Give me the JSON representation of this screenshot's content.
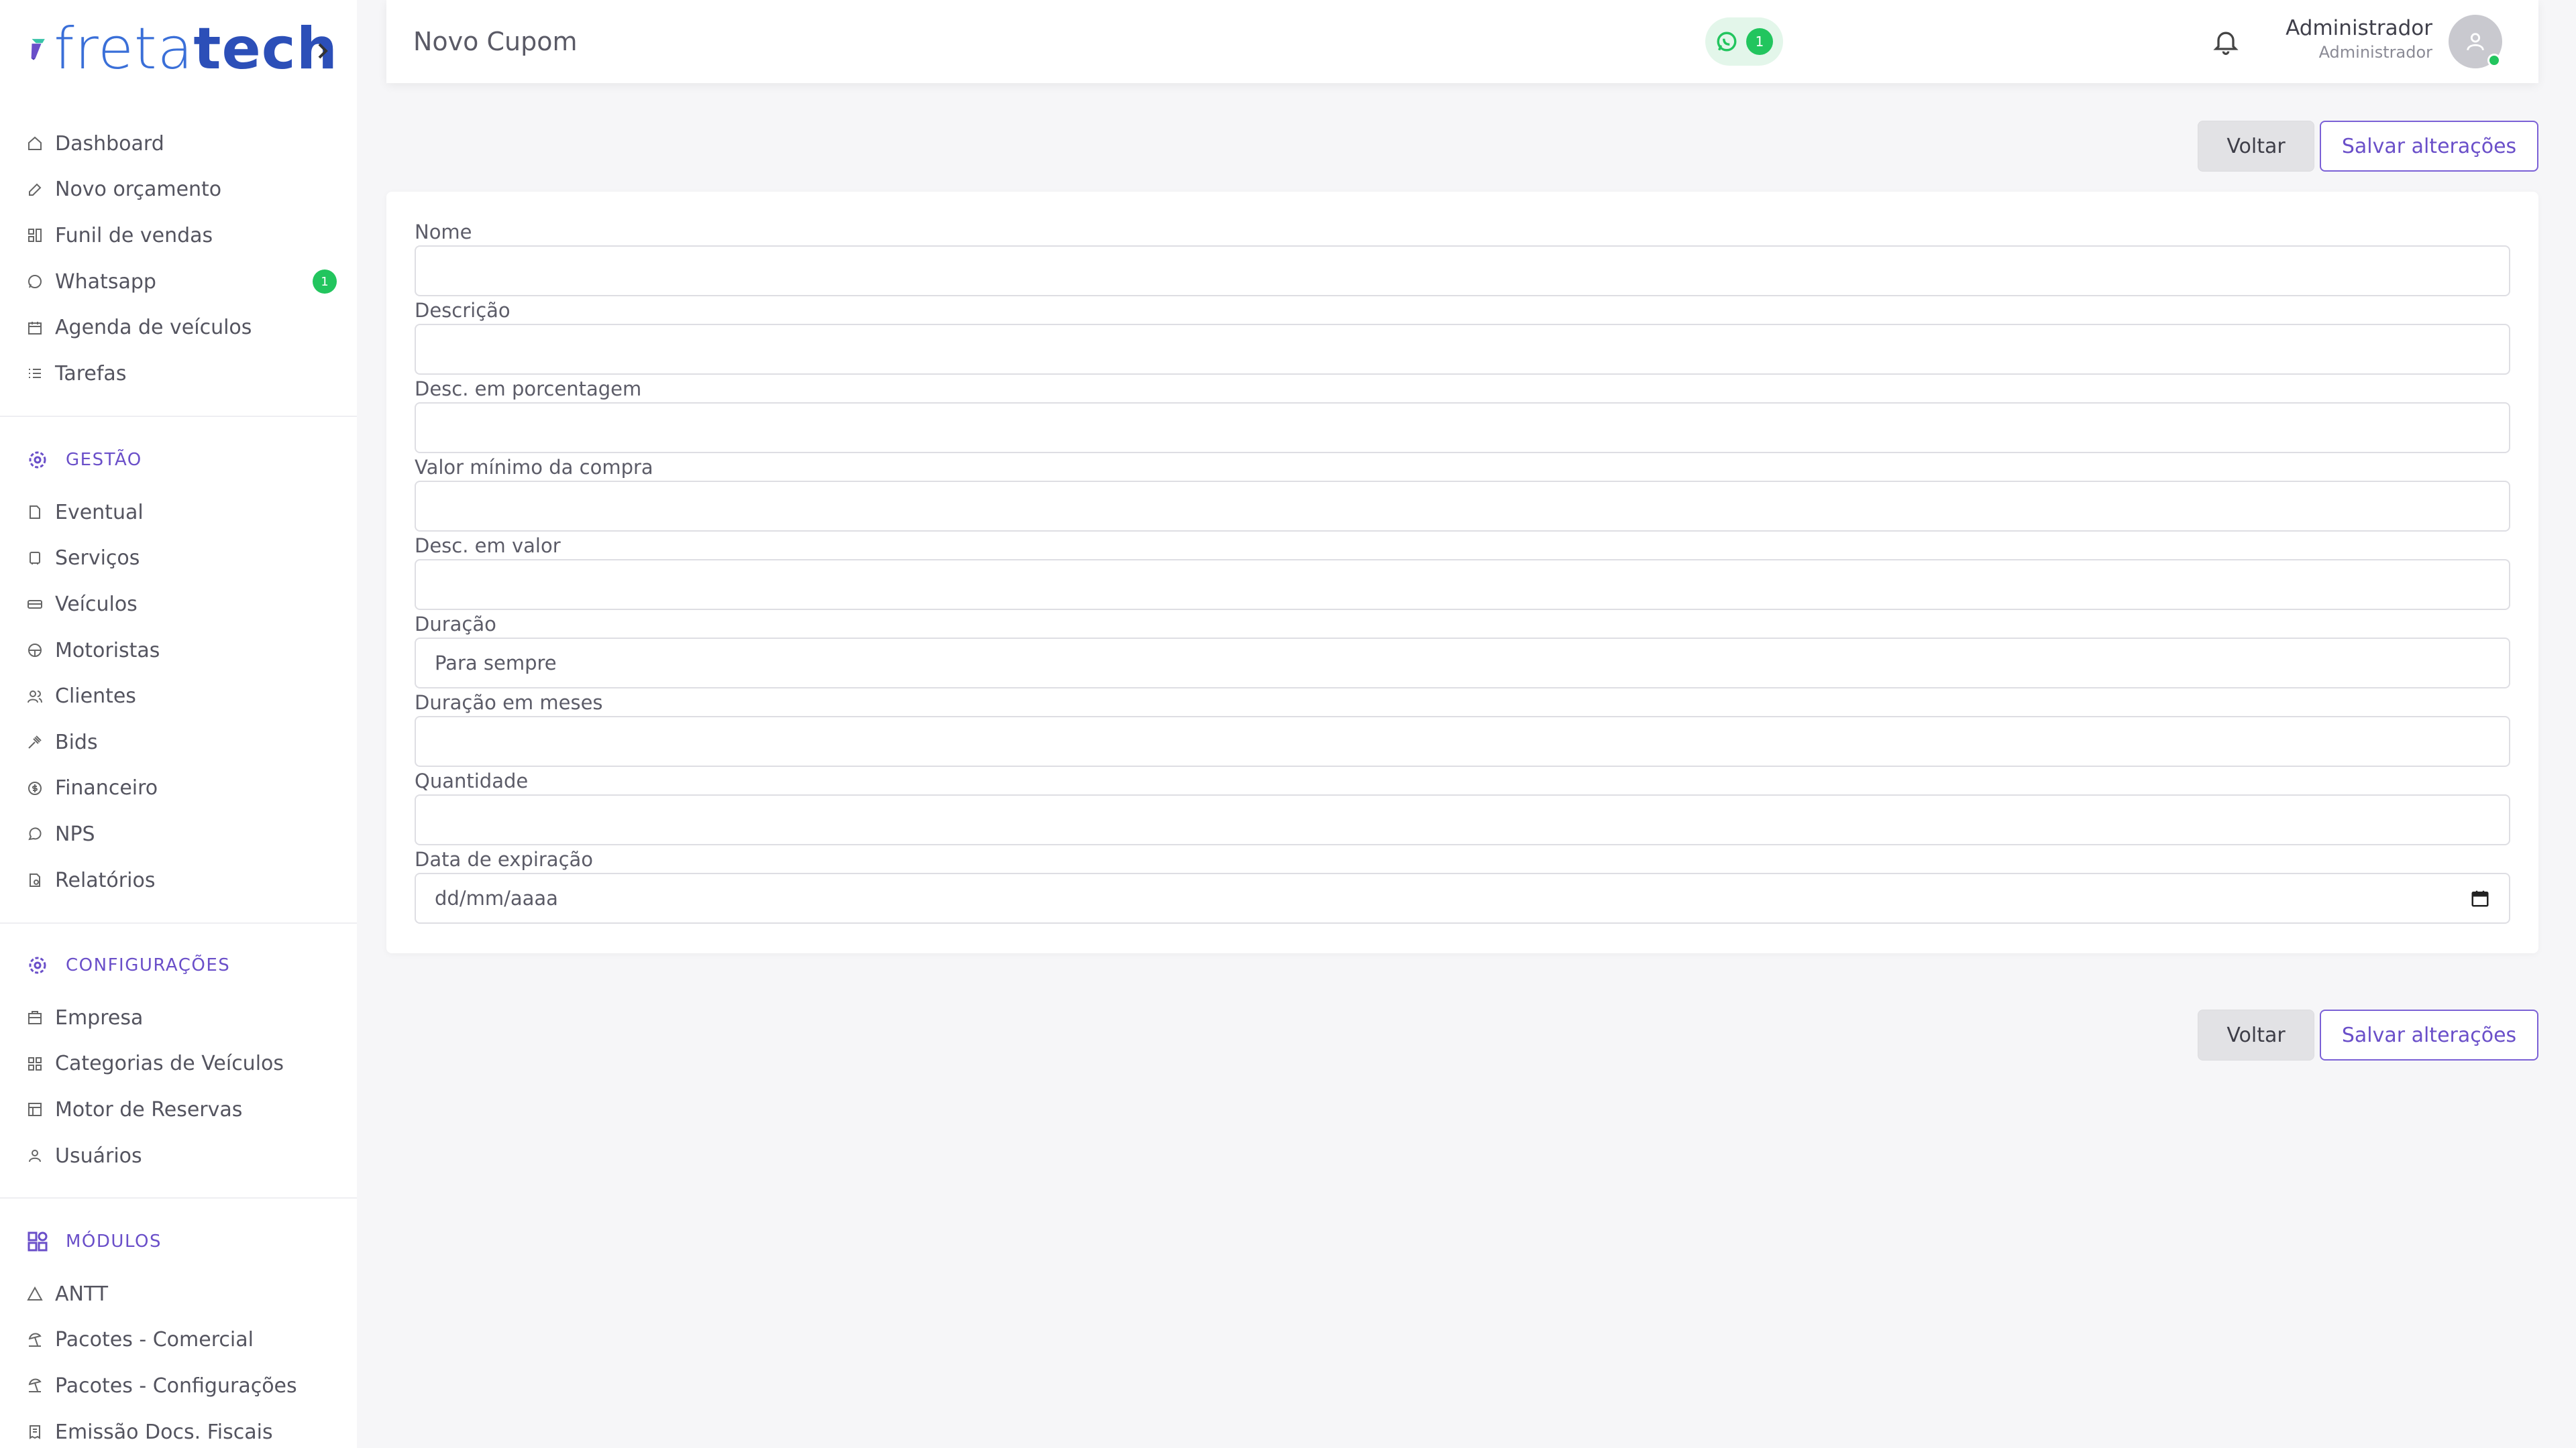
{
  "brand": {
    "name_part1": "freta",
    "name_part2": "tech"
  },
  "sidebar": {
    "main_items": [
      {
        "label": "Dashboard",
        "icon": "home-icon"
      },
      {
        "label": "Novo orçamento",
        "icon": "edit-icon"
      },
      {
        "label": "Funil de vendas",
        "icon": "funnel-icon"
      },
      {
        "label": "Whatsapp",
        "icon": "whatsapp-icon",
        "badge": "1"
      },
      {
        "label": "Agenda de veículos",
        "icon": "calendar-icon"
      },
      {
        "label": "Tarefas",
        "icon": "list-icon"
      }
    ],
    "gestao_title": "GESTÃO",
    "gestao_items": [
      {
        "label": "Eventual",
        "icon": "document-icon"
      },
      {
        "label": "Serviços",
        "icon": "bus-icon"
      },
      {
        "label": "Veículos",
        "icon": "car-icon"
      },
      {
        "label": "Motoristas",
        "icon": "steering-wheel-icon"
      },
      {
        "label": "Clientes",
        "icon": "users-icon"
      },
      {
        "label": "Bids",
        "icon": "gavel-icon"
      },
      {
        "label": "Financeiro",
        "icon": "dollar-icon"
      },
      {
        "label": "NPS",
        "icon": "chat-icon"
      },
      {
        "label": "Relatórios",
        "icon": "report-icon"
      }
    ],
    "config_title": "CONFIGURAÇÕES",
    "config_items": [
      {
        "label": "Empresa",
        "icon": "building-icon"
      },
      {
        "label": "Categorias de Veículos",
        "icon": "grid-icon"
      },
      {
        "label": "Motor de Reservas",
        "icon": "table-icon"
      },
      {
        "label": "Usuários",
        "icon": "user-icon"
      }
    ],
    "modulos_title": "MÓDULOS",
    "modulos_items": [
      {
        "label": "ANTT",
        "icon": "triangle-icon"
      },
      {
        "label": "Pacotes - Comercial",
        "icon": "beach-icon"
      },
      {
        "label": "Pacotes - Configurações",
        "icon": "beach-icon"
      },
      {
        "label": "Emissão Docs. Fiscais",
        "icon": "receipt-icon"
      }
    ]
  },
  "header": {
    "title": "Novo Cupom",
    "whatsapp_count": "1",
    "user_name": "Administrador",
    "user_role": "Administrador"
  },
  "actions": {
    "back_label": "Voltar",
    "save_label": "Salvar alterações"
  },
  "form": {
    "fields": [
      {
        "label": "Nome",
        "value": ""
      },
      {
        "label": "Descrição",
        "value": ""
      },
      {
        "label": "Desc. em porcentagem",
        "value": ""
      },
      {
        "label": "Valor mínimo da compra",
        "value": ""
      },
      {
        "label": "Desc. em valor",
        "value": ""
      },
      {
        "label": "Duração",
        "value": "Para sempre"
      },
      {
        "label": "Duração em meses",
        "value": ""
      },
      {
        "label": "Quantidade",
        "value": ""
      },
      {
        "label": "Data de expiração",
        "value": "dd/mm/aaaa"
      }
    ]
  },
  "colors": {
    "accent": "#6a4fc9",
    "success": "#22c55e",
    "brand_blue": "#3a6fd8"
  }
}
